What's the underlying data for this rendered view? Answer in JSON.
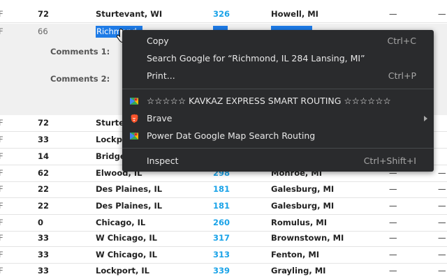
{
  "rows": [
    {
      "flag": "F",
      "num": "72",
      "origin": "Sturtevant, WI",
      "dist": "326",
      "dest": "Howell, MI",
      "dash": "—",
      "dash2": "—"
    },
    {
      "flag": "F",
      "num": "66",
      "origin": "Richmond",
      "dist": "",
      "dest": "",
      "dash": "",
      "dash2": ""
    },
    {
      "flag": "F",
      "num": "72",
      "origin": "Sturtevant, WI",
      "dist": "",
      "dest": "",
      "dash": "",
      "dash2": ""
    },
    {
      "flag": "F",
      "num": "33",
      "origin": "Lockport, IL",
      "dist": "",
      "dest": "",
      "dash": "",
      "dash2": ""
    },
    {
      "flag": "F",
      "num": "14",
      "origin": "Bridgeview, IL",
      "dist": "",
      "dest": "",
      "dash": "",
      "dash2": ""
    },
    {
      "flag": "F",
      "num": "62",
      "origin": "Elwood, IL",
      "dist": "298",
      "dest": "Monroe, MI",
      "dash": "—",
      "dash2": "—"
    },
    {
      "flag": "F",
      "num": "22",
      "origin": "Des Plaines, IL",
      "dist": "181",
      "dest": "Galesburg, MI",
      "dash": "—",
      "dash2": "—"
    },
    {
      "flag": "F",
      "num": "22",
      "origin": "Des Plaines, IL",
      "dist": "181",
      "dest": "Galesburg, MI",
      "dash": "—",
      "dash2": "—"
    },
    {
      "flag": "F",
      "num": "0",
      "origin": "Chicago, IL",
      "dist": "260",
      "dest": "Romulus, MI",
      "dash": "—",
      "dash2": "—"
    },
    {
      "flag": "F",
      "num": "33",
      "origin": "W Chicago, IL",
      "dist": "317",
      "dest": "Brownstown, MI",
      "dash": "—",
      "dash2": "—"
    },
    {
      "flag": "F",
      "num": "33",
      "origin": "W Chicago, IL",
      "dist": "313",
      "dest": "Fenton, MI",
      "dash": "—",
      "dash2": "—"
    },
    {
      "flag": "F",
      "num": "33",
      "origin": "Lockport, IL",
      "dist": "339",
      "dest": "Grayling, MI",
      "dash": "—",
      "dash2": "—"
    }
  ],
  "details": {
    "comments1_label": "Comments 1:",
    "comments2_label": "Comments 2:"
  },
  "context_menu": {
    "copy": {
      "label": "Copy",
      "shortcut": "Ctrl+C"
    },
    "search": {
      "label": "Search Google for “Richmond, IL 284 Lansing, MI”"
    },
    "print": {
      "label": "Print...",
      "shortcut": "Ctrl+P"
    },
    "kavkaz": {
      "label": "☆☆☆☆☆ KAVKAZ EXPRESS SMART ROUTING ☆☆☆☆☆☆",
      "icon": "maps-icon"
    },
    "brave": {
      "label": "Brave",
      "icon": "brave-lion-icon"
    },
    "powerdat": {
      "label": "Power Dat Google Map Search Routing",
      "icon": "maps-icon"
    },
    "inspect": {
      "label": "Inspect",
      "shortcut": "Ctrl+Shift+I"
    }
  },
  "colors": {
    "link_blue": "#1aa3e8",
    "selection_blue": "#1e7be6",
    "menu_bg": "#2a2b2d",
    "brave_orange": "#fb542b"
  }
}
